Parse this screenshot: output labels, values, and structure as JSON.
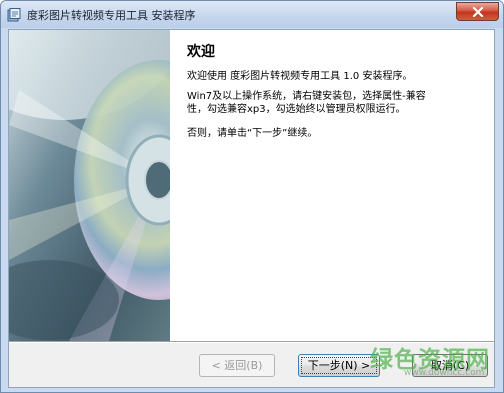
{
  "window": {
    "title": "度彩图片转视频专用工具 安装程序",
    "close_glyph": "✕"
  },
  "content": {
    "heading": "欢迎",
    "line1": "欢迎使用 度彩图片转视频专用工具 1.0 安装程序。",
    "line2a": "Win7及以上操作系统，请右键安装包，选择属性-兼容",
    "line2b": "性，勾选兼容xp3，勾选始终以管理员权限运行。",
    "line3": "否则，请单击“下一步”继续。"
  },
  "buttons": {
    "back": "< 返回(B)",
    "next": "下一步(N) >",
    "cancel": "取消(C)"
  },
  "watermark": {
    "text": "绿色资源网",
    "url": "www.downcc.com"
  },
  "colors": {
    "titlebar": "#c6d7ee",
    "close_button": "#c2321d",
    "dialog_bg": "#f0f0f0",
    "focus_border": "#3c7fb1"
  }
}
